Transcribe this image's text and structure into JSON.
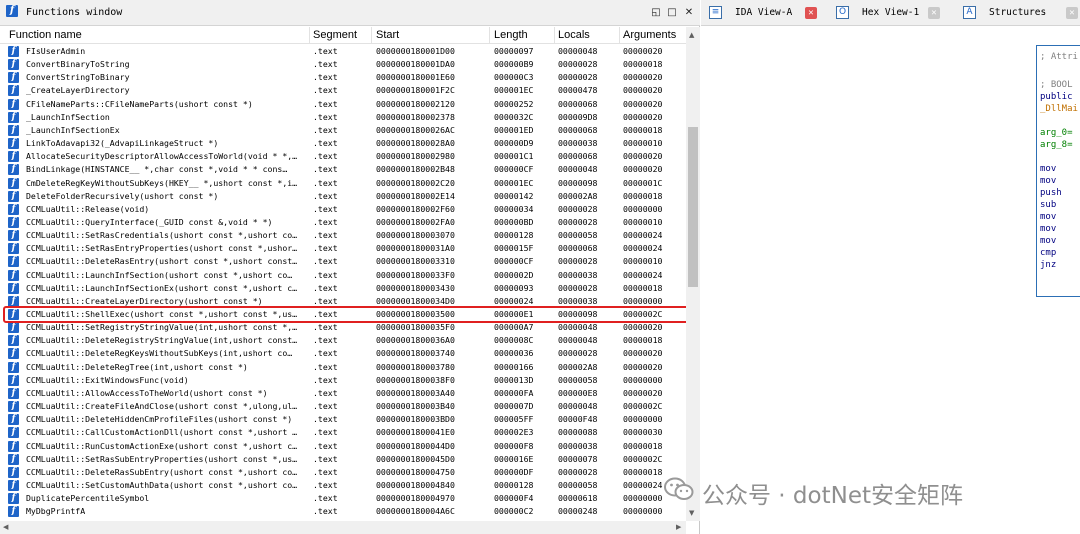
{
  "functions_window": {
    "title": "Functions window",
    "columns": [
      "Function name",
      "Segment",
      "Start",
      "Length",
      "Locals",
      "Arguments"
    ],
    "selected_index": 20,
    "rows": [
      [
        "FIsUserAdmin",
        ".text",
        "0000000180001D00",
        "00000097",
        "00000048",
        "00000020"
      ],
      [
        "ConvertBinaryToString",
        ".text",
        "0000000180001DA0",
        "000000B9",
        "00000028",
        "00000018"
      ],
      [
        "ConvertStringToBinary",
        ".text",
        "0000000180001E60",
        "000000C3",
        "00000028",
        "00000020"
      ],
      [
        "_CreateLayerDirectory",
        ".text",
        "0000000180001F2C",
        "000001EC",
        "00000478",
        "00000020"
      ],
      [
        "CFileNameParts::CFileNameParts(ushort const *)",
        ".text",
        "0000000180002120",
        "00000252",
        "00000068",
        "00000020"
      ],
      [
        "_LaunchInfSection",
        ".text",
        "0000000180002378",
        "0000032C",
        "000009D8",
        "00000020"
      ],
      [
        "_LaunchInfSectionEx",
        ".text",
        "00000001800026AC",
        "000001ED",
        "00000068",
        "00000018"
      ],
      [
        "LinkToAdavapi32(_AdvapiLinkageStruct *)",
        ".text",
        "00000001800028A0",
        "000000D9",
        "00000038",
        "00000010"
      ],
      [
        "AllocateSecurityDescriptorAllowAccessToWorld(void * *,…",
        ".text",
        "0000000180002980",
        "000001C1",
        "00000068",
        "00000020"
      ],
      [
        "BindLinkage(HINSTANCE__ *,char const *,void * * cons…",
        ".text",
        "0000000180002B48",
        "000000CF",
        "00000048",
        "00000020"
      ],
      [
        "CmDeleteRegKeyWithoutSubKeys(HKEY__ *,ushort const *,i…",
        ".text",
        "0000000180002C20",
        "000001EC",
        "00000098",
        "0000001C"
      ],
      [
        "DeleteFolderRecursively(ushort const *)",
        ".text",
        "0000000180002E14",
        "00000142",
        "000002A8",
        "00000018"
      ],
      [
        "CCMLuaUtil::Release(void)",
        ".text",
        "0000000180002F60",
        "00000034",
        "00000028",
        "00000000"
      ],
      [
        "CCMLuaUtil::QueryInterface(_GUID const &,void * *)",
        ".text",
        "0000000180002FA0",
        "000000BD",
        "00000028",
        "00000010"
      ],
      [
        "CCMLuaUtil::SetRasCredentials(ushort const *,ushort co…",
        ".text",
        "0000000180003070",
        "00000128",
        "00000058",
        "00000024"
      ],
      [
        "CCMLuaUtil::SetRasEntryProperties(ushort const *,ushor…",
        ".text",
        "00000001800031A0",
        "0000015F",
        "00000068",
        "00000024"
      ],
      [
        "CCMLuaUtil::DeleteRasEntry(ushort const *,ushort const…",
        ".text",
        "0000000180003310",
        "000000CF",
        "00000028",
        "00000010"
      ],
      [
        "CCMLuaUtil::LaunchInfSection(ushort const *,ushort co…",
        ".text",
        "00000001800033F0",
        "0000002D",
        "00000038",
        "00000024"
      ],
      [
        "CCMLuaUtil::LaunchInfSectionEx(ushort const *,ushort c…",
        ".text",
        "0000000180003430",
        "00000093",
        "00000028",
        "00000018"
      ],
      [
        "CCMLuaUtil::CreateLayerDirectory(ushort const *)",
        ".text",
        "00000001800034D0",
        "00000024",
        "00000038",
        "00000000"
      ],
      [
        "CCMLuaUtil::ShellExec(ushort const *,ushort const *,us…",
        ".text",
        "0000000180003500",
        "000000E1",
        "00000098",
        "0000002C"
      ],
      [
        "CCMLuaUtil::SetRegistryStringValue(int,ushort const *,…",
        ".text",
        "00000001800035F0",
        "000000A7",
        "00000048",
        "00000020"
      ],
      [
        "CCMLuaUtil::DeleteRegistryStringValue(int,ushort const…",
        ".text",
        "00000001800036A0",
        "0000008C",
        "00000048",
        "00000018"
      ],
      [
        "CCMLuaUtil::DeleteRegKeysWithoutSubKeys(int,ushort co…",
        ".text",
        "0000000180003740",
        "00000036",
        "00000028",
        "00000020"
      ],
      [
        "CCMLuaUtil::DeleteRegTree(int,ushort const *)",
        ".text",
        "0000000180003780",
        "00000166",
        "000002A8",
        "00000020"
      ],
      [
        "CCMLuaUtil::ExitWindowsFunc(void)",
        ".text",
        "00000001800038F0",
        "0000013D",
        "00000058",
        "00000000"
      ],
      [
        "CCMLuaUtil::AllowAccessToTheWorld(ushort const *)",
        ".text",
        "0000000180003A40",
        "000000FA",
        "000000E8",
        "00000020"
      ],
      [
        "CCMLuaUtil::CreateFileAndClose(ushort const *,ulong,ul…",
        ".text",
        "0000000180003B40",
        "0000007D",
        "00000048",
        "0000002C"
      ],
      [
        "CCMLuaUtil::DeleteHiddenCmProfileFiles(ushort const *)",
        ".text",
        "0000000180003BD0",
        "000005FF",
        "00000F48",
        "00000000"
      ],
      [
        "CCMLuaUtil::CallCustomActionDll(ushort const *,ushort …",
        ".text",
        "00000001800041E0",
        "000002E3",
        "00000088",
        "00000030"
      ],
      [
        "CCMLuaUtil::RunCustomActionExe(ushort const *,ushort c…",
        ".text",
        "00000001800044D0",
        "000000F8",
        "00000038",
        "00000018"
      ],
      [
        "CCMLuaUtil::SetRasSubEntryProperties(ushort const *,us…",
        ".text",
        "00000001800045D0",
        "0000016E",
        "00000078",
        "0000002C"
      ],
      [
        "CCMLuaUtil::DeleteRasSubEntry(ushort const *,ushort co…",
        ".text",
        "0000000180004750",
        "000000DF",
        "00000028",
        "00000018"
      ],
      [
        "CCMLuaUtil::SetCustomAuthData(ushort const *,ushort co…",
        ".text",
        "0000000180004840",
        "00000128",
        "00000058",
        "00000024"
      ],
      [
        "DuplicatePercentileSymbol",
        ".text",
        "0000000180004970",
        "000000F4",
        "00000618",
        "00000000"
      ],
      [
        "MyDbgPrintfA",
        ".text",
        "0000000180004A6C",
        "000000C2",
        "00000248",
        "00000000"
      ]
    ]
  },
  "tabs": [
    {
      "label": "IDA View-A",
      "icon": "IDA"
    },
    {
      "label": "Hex View-1",
      "icon": "O"
    },
    {
      "label": "Structures",
      "icon": "A"
    }
  ],
  "asm_lines": [
    "; Attri",
    "; BOOL",
    "public",
    "_DllMai",
    "arg_0= ",
    "arg_8= ",
    "mov",
    "mov",
    "push",
    "sub",
    "mov",
    "mov",
    "mov",
    "cmp",
    "jnz"
  ],
  "watermark": "公众号 · dotNet安全矩阵",
  "colors": {
    "accent": "#1e64c8",
    "selection_border": "#e02020",
    "asm_keyword": "#000080",
    "asm_comment": "#808080"
  }
}
